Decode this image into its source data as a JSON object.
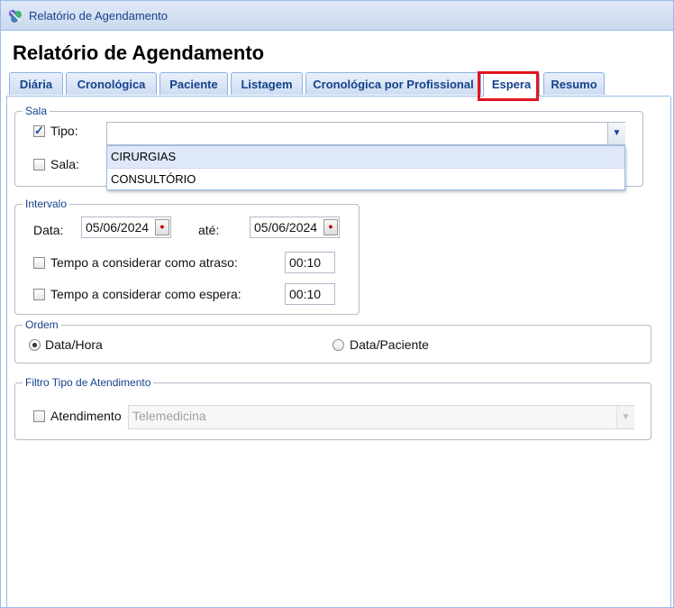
{
  "window": {
    "title": "Relatório de Agendamento"
  },
  "page": {
    "heading": "Relatório de Agendamento"
  },
  "tabs": [
    {
      "label": "Diária"
    },
    {
      "label": "Cronológica"
    },
    {
      "label": "Paciente"
    },
    {
      "label": "Listagem"
    },
    {
      "label": "Cronológica por Profissional"
    },
    {
      "label": "Espera",
      "active": true
    },
    {
      "label": "Resumo"
    }
  ],
  "sala": {
    "legend": "Sala",
    "tipo_label": "Tipo:",
    "tipo_checked": true,
    "tipo_value": "",
    "sala_label": "Sala:",
    "sala_checked": false,
    "options": [
      "CIRURGIAS",
      "CONSULTÓRIO"
    ]
  },
  "intervalo": {
    "legend": "Intervalo",
    "data_label": "Data:",
    "data_value": "05/06/2024",
    "ate_label": "até:",
    "ate_value": "05/06/2024",
    "atraso_label": "Tempo a considerar como atraso:",
    "atraso_value": "00:10",
    "espera_label": "Tempo a considerar como espera:",
    "espera_value": "00:10"
  },
  "ordem": {
    "legend": "Ordem",
    "opt1": "Data/Hora",
    "opt2": "Data/Paciente",
    "selected": "Data/Hora"
  },
  "filtro": {
    "legend": "Filtro Tipo de Atendimento",
    "atendimento_label": "Atendimento",
    "atendimento_value": "Telemedicina"
  },
  "colors": {
    "highlight": "#e0161f",
    "accent": "#15428b"
  }
}
